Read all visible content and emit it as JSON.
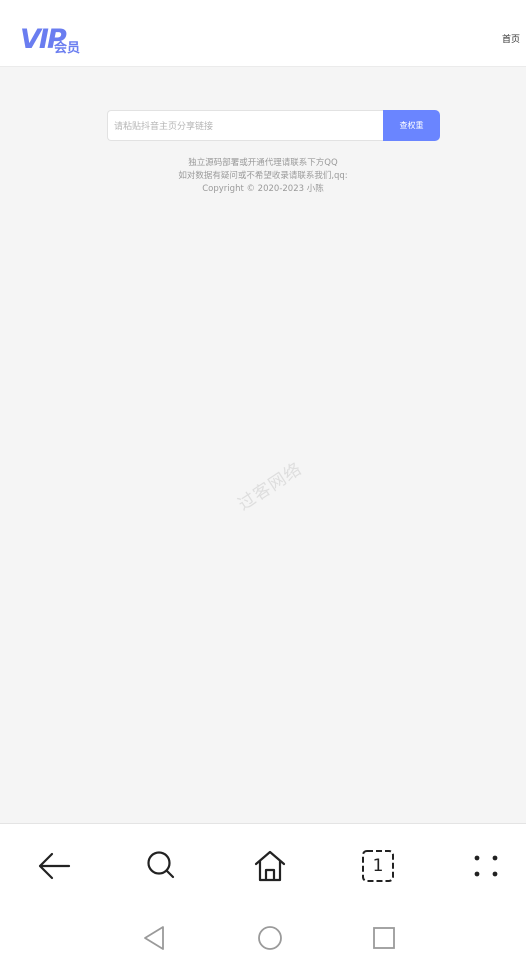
{
  "header": {
    "logo_text": "VIP会员",
    "nav_home": "首页"
  },
  "search": {
    "placeholder": "请粘贴抖音主页分享链接",
    "button_label": "查权重"
  },
  "info": {
    "line1": "独立源码部署或开通代理请联系下方QQ",
    "line2": "如对数据有疑问或不希望收录请联系我们,qq:",
    "line3": "Copyright © 2020-2023 小陈"
  },
  "watermark": "过客网络",
  "browser": {
    "tabs_count": "1",
    "icons": [
      "back-icon",
      "search-icon",
      "home-icon",
      "tabs-icon",
      "menu-icon"
    ]
  },
  "system_nav": {
    "icons": [
      "back-triangle-icon",
      "home-circle-icon",
      "recents-square-icon"
    ]
  },
  "colors": {
    "accent": "#6a85ff",
    "logo": "#6a7df0",
    "background": "#f5f5f5"
  }
}
